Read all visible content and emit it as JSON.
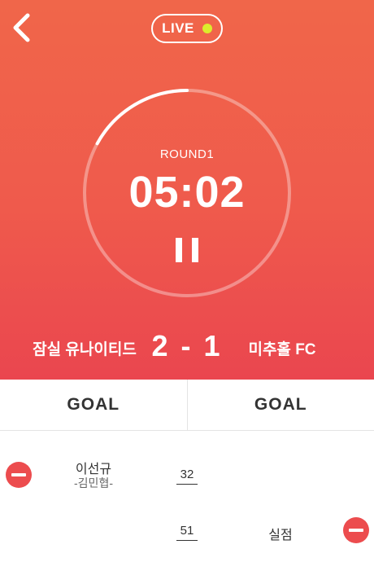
{
  "header": {
    "back_icon": "chevron-left-icon",
    "live_label": "LIVE",
    "live_dot_color": "#dcec2c"
  },
  "timer": {
    "round_label": "ROUND1",
    "time": "05:02",
    "progress": 0.17,
    "pause_icon": "pause-icon"
  },
  "scoreboard": {
    "home_team": "잠실 유나이티드",
    "score": "2 - 1",
    "away_team": "미추홀 FC"
  },
  "actions": {
    "home_goal_label": "GOAL",
    "away_goal_label": "GOAL"
  },
  "events": [
    {
      "side": "home",
      "player": "이선규",
      "assist": "-김민협-",
      "minute": "32"
    },
    {
      "side": "away",
      "label": "실점",
      "minute": "51"
    }
  ],
  "colors": {
    "accent": "#ec4c4e",
    "gradient_top": "#f0664a",
    "gradient_bottom": "#ea464f"
  }
}
